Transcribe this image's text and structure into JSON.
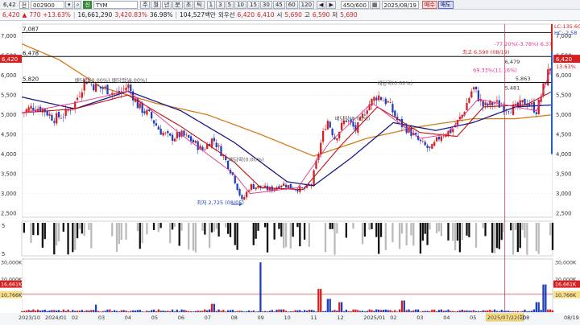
{
  "toolbar": {
    "account_prefix": "6,42",
    "market_select": "전",
    "stock_code": "002900",
    "stock_name_badge": "신",
    "stock_name": "TYM",
    "periods": [
      "주",
      "월",
      "년",
      "분",
      "초",
      "틱"
    ],
    "intervals": [
      "1",
      "3",
      "5",
      "10",
      "15",
      "30",
      "45",
      "60",
      "120"
    ],
    "count_value": "450/600",
    "date_value": "2025/08/19",
    "buy_label": "매수",
    "sell_label": "매도"
  },
  "quote": {
    "price": "6,420",
    "change": "770 +13.63%",
    "volume": "16,661,290",
    "volume_ratio": "3,420.83%",
    "ratio2": "36.98%",
    "trade_value": "104,527백만",
    "extra_label": "외우선",
    "prev_price": "6,420",
    "open": "6,410",
    "open_label": "시",
    "open_value": "5,690",
    "high_label": "고",
    "high_value": "6,590",
    "low_label": "저",
    "low_value": "5,690"
  },
  "colors": {
    "up": "#d42020",
    "down": "#1f3fbf",
    "ma5": "#e0348a",
    "ma20": "#c01010",
    "ma60": "#1a1a8a",
    "ma120": "#d67a16",
    "crosshair": "#c04060"
  },
  "chart_data": {
    "type": "candlestick",
    "price_axis": {
      "ticks": [
        "7,000",
        "6,500",
        "6,000",
        "5,500",
        "5,000",
        "4,500",
        "4,000",
        "3,500",
        "3,000",
        "2,500"
      ],
      "tick_values": [
        7000,
        6500,
        6000,
        5500,
        5000,
        4500,
        4000,
        3500,
        3000,
        2500
      ],
      "range": [
        2400,
        7300
      ]
    },
    "right_axis": [
      "6,420",
      "13.63%",
      "7,000",
      "6,500",
      "6,000",
      "5,500",
      "5,000",
      "4,500",
      "4,000",
      "3,500",
      "3,000",
      "2,500"
    ],
    "current_price": "6,420",
    "current_price_right": "6,420",
    "current_pct_right": "13.63%",
    "corner_labels": [
      "LC:135.60",
      "HC:-2.58"
    ],
    "horizontal_levels": [
      {
        "label": "7,087",
        "value": 7087
      },
      {
        "label": "6,478",
        "value": 6478
      },
      {
        "label": "5,820",
        "value": 5820
      }
    ],
    "annotations": [
      {
        "text": "-77.20%(-3.78%) 6,37",
        "date_index": 0.89,
        "price": 6750,
        "color": "#e0348a"
      },
      {
        "text": "최고 6,590 (08/19)",
        "date_index": 0.83,
        "price": 6540,
        "color": "#d42020"
      },
      {
        "text": "69.33%(11.16%)",
        "date_index": 0.85,
        "price": 6090,
        "color": "#e0348a"
      },
      {
        "text": "6,479",
        "date_index": 0.91,
        "price": 6300,
        "color": "#333333"
      },
      {
        "text": "5,863",
        "date_index": 0.93,
        "price": 5870,
        "color": "#333333"
      },
      {
        "text": "5,481",
        "date_index": 0.91,
        "price": 5640,
        "color": "#333333"
      },
      {
        "text": "최저 2,725 (08/05)",
        "date_index": 0.33,
        "price": 2725,
        "color": "#1f3fbf"
      },
      {
        "text": "배당락(0.00%)",
        "date_index": 0.1,
        "price": 5830,
        "color": "#555555"
      },
      {
        "text": "배당락(0.00%)",
        "date_index": 0.17,
        "price": 5830,
        "color": "#555555"
      },
      {
        "text": "배당락(0.00%)",
        "date_index": 0.39,
        "price": 3820,
        "color": "#555555"
      },
      {
        "text": "배당락(0.00%)",
        "date_index": 0.59,
        "price": 4860,
        "color": "#555555"
      },
      {
        "text": "배당락(0.00%)",
        "date_index": 0.67,
        "price": 5760,
        "color": "#555555"
      }
    ],
    "x_ticks": [
      "2023/10",
      "2024/01",
      "02",
      "03",
      "04",
      "05",
      "06",
      "07",
      "08",
      "09",
      "10",
      "11",
      "12",
      "2025/01",
      "02",
      "03",
      "04",
      "05",
      "06",
      "2025/07/22(화)",
      "08",
      "08/19"
    ],
    "volume_axis": {
      "ticks": [
        "30,000K",
        "20,000K",
        "10,000K"
      ],
      "tick_values": [
        30000,
        20000,
        10000
      ],
      "range": [
        0,
        32000
      ]
    },
    "volume_right_labels": [
      "16,661K",
      "10,766K"
    ],
    "volume_left_labels": [
      "16,661K",
      "10,766K"
    ],
    "signal_axis": [
      "5",
      "5"
    ],
    "price_keypoints": [
      [
        0,
        5050
      ],
      [
        0.02,
        5200
      ],
      [
        0.04,
        5150
      ],
      [
        0.06,
        4900
      ],
      [
        0.08,
        5000
      ],
      [
        0.1,
        5300
      ],
      [
        0.12,
        5900
      ],
      [
        0.14,
        5700
      ],
      [
        0.16,
        5650
      ],
      [
        0.18,
        5500
      ],
      [
        0.2,
        5750
      ],
      [
        0.22,
        5200
      ],
      [
        0.24,
        5000
      ],
      [
        0.26,
        4600
      ],
      [
        0.28,
        4400
      ],
      [
        0.3,
        4500
      ],
      [
        0.32,
        4350
      ],
      [
        0.34,
        4100
      ],
      [
        0.36,
        4400
      ],
      [
        0.38,
        3950
      ],
      [
        0.4,
        3400
      ],
      [
        0.415,
        2800
      ],
      [
        0.43,
        3200
      ],
      [
        0.45,
        3150
      ],
      [
        0.47,
        3100
      ],
      [
        0.49,
        3250
      ],
      [
        0.51,
        3150
      ],
      [
        0.53,
        3100
      ],
      [
        0.545,
        3200
      ],
      [
        0.56,
        4100
      ],
      [
        0.575,
        4900
      ],
      [
        0.59,
        4400
      ],
      [
        0.61,
        4900
      ],
      [
        0.63,
        4600
      ],
      [
        0.65,
        5200
      ],
      [
        0.67,
        5500
      ],
      [
        0.69,
        5300
      ],
      [
        0.71,
        4800
      ],
      [
        0.73,
        4600
      ],
      [
        0.75,
        4300
      ],
      [
        0.77,
        4100
      ],
      [
        0.79,
        4500
      ],
      [
        0.81,
        4600
      ],
      [
        0.83,
        5000
      ],
      [
        0.85,
        5700
      ],
      [
        0.87,
        5200
      ],
      [
        0.89,
        5300
      ],
      [
        0.91,
        5200
      ],
      [
        0.93,
        5150
      ],
      [
        0.95,
        5350
      ],
      [
        0.97,
        5100
      ],
      [
        0.985,
        5800
      ],
      [
        1,
        6420
      ]
    ],
    "ma_keypoints": {
      "ma5": [
        [
          0,
          5050
        ],
        [
          0.1,
          5300
        ],
        [
          0.2,
          5600
        ],
        [
          0.3,
          4500
        ],
        [
          0.4,
          3500
        ],
        [
          0.43,
          3000
        ],
        [
          0.52,
          3150
        ],
        [
          0.58,
          4300
        ],
        [
          0.66,
          5300
        ],
        [
          0.75,
          4400
        ],
        [
          0.8,
          4500
        ],
        [
          0.86,
          5400
        ],
        [
          0.93,
          5200
        ],
        [
          0.97,
          5100
        ],
        [
          1,
          6300
        ]
      ],
      "ma20": [
        [
          0,
          5050
        ],
        [
          0.1,
          5150
        ],
        [
          0.2,
          5500
        ],
        [
          0.3,
          4700
        ],
        [
          0.4,
          3800
        ],
        [
          0.45,
          3150
        ],
        [
          0.53,
          3100
        ],
        [
          0.6,
          4200
        ],
        [
          0.67,
          5200
        ],
        [
          0.75,
          4550
        ],
        [
          0.82,
          4450
        ],
        [
          0.87,
          5200
        ],
        [
          0.95,
          5250
        ],
        [
          1,
          5600
        ]
      ],
      "ma60": [
        [
          0,
          5450
        ],
        [
          0.1,
          5150
        ],
        [
          0.2,
          5600
        ],
        [
          0.3,
          5100
        ],
        [
          0.4,
          4300
        ],
        [
          0.5,
          3300
        ],
        [
          0.55,
          3200
        ],
        [
          0.62,
          3900
        ],
        [
          0.7,
          4800
        ],
        [
          0.78,
          4600
        ],
        [
          0.85,
          4800
        ],
        [
          0.93,
          5200
        ],
        [
          1,
          5250
        ]
      ],
      "ma120": [
        [
          0,
          6800
        ],
        [
          0.07,
          6400
        ],
        [
          0.15,
          5700
        ],
        [
          0.25,
          5300
        ],
        [
          0.35,
          5000
        ],
        [
          0.45,
          4500
        ],
        [
          0.55,
          3950
        ],
        [
          0.65,
          4400
        ],
        [
          0.75,
          4700
        ],
        [
          0.85,
          4900
        ],
        [
          0.93,
          4900
        ],
        [
          1,
          5000
        ]
      ]
    }
  }
}
